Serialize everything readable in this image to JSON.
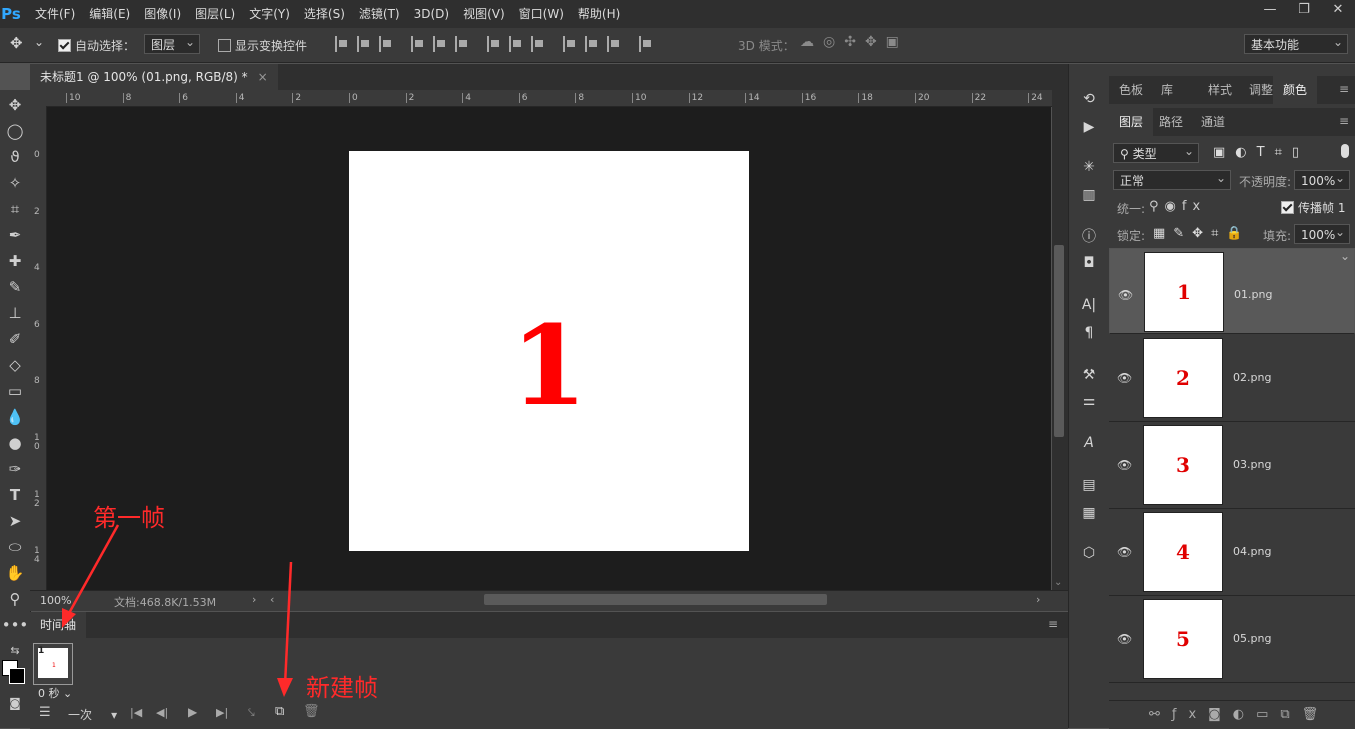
{
  "app": {
    "logo": "Ps"
  },
  "menu": [
    "文件(F)",
    "编辑(E)",
    "图像(I)",
    "图层(L)",
    "文字(Y)",
    "选择(S)",
    "滤镜(T)",
    "3D(D)",
    "视图(V)",
    "窗口(W)",
    "帮助(H)"
  ],
  "window_controls": [
    "—",
    "❐",
    "✕"
  ],
  "options": {
    "auto_select_label": "自动选择：",
    "auto_select_value": "图层",
    "show_transform_label": "显示变换控件",
    "mode_3d_label": "3D 模式：",
    "workspace": "基本功能"
  },
  "document": {
    "tab_title": "未标题1 @ 100% (01.png, RGB/8) *",
    "close": "×",
    "canvas_text": "1",
    "zoom": "100%",
    "doc_info": "文档:468.8K/1.53M"
  },
  "rulers": {
    "h": [
      "10",
      "8",
      "6",
      "4",
      "2",
      "0",
      "2",
      "4",
      "6",
      "8",
      "10",
      "12",
      "14",
      "16",
      "18",
      "20",
      "22",
      "24"
    ],
    "v": [
      "0",
      "2",
      "4",
      "6",
      "8",
      "1\n0",
      "1\n2",
      "1\n4"
    ]
  },
  "timeline": {
    "tab": "时间轴",
    "frame_number": "1",
    "frame_delay": "0 秒",
    "loop": "一次"
  },
  "panels": {
    "top_tabs": [
      "色板",
      "库",
      "样式",
      "调整",
      "颜色"
    ],
    "layer_tabs": [
      "图层",
      "路径",
      "通道"
    ],
    "filter_kind": "类型",
    "blend_mode": "正常",
    "opacity_label": "不透明度:",
    "opacity_value": "100%",
    "unify_label": "统一:",
    "propagate_label": "传播帧",
    "propagate_value": "1",
    "lock_label": "锁定:",
    "fill_label": "填充:",
    "fill_value": "100%"
  },
  "layers": [
    {
      "name": "01.png",
      "thumb": "1",
      "selected": true
    },
    {
      "name": "02.png",
      "thumb": "2",
      "selected": false
    },
    {
      "name": "03.png",
      "thumb": "3",
      "selected": false
    },
    {
      "name": "04.png",
      "thumb": "4",
      "selected": false
    },
    {
      "name": "05.png",
      "thumb": "5",
      "selected": false
    }
  ],
  "annotations": {
    "first_frame": "第一帧",
    "new_frame": "新建帧"
  },
  "colors": {
    "accent_red": "#ff0000",
    "ps_blue": "#31a8ff"
  }
}
